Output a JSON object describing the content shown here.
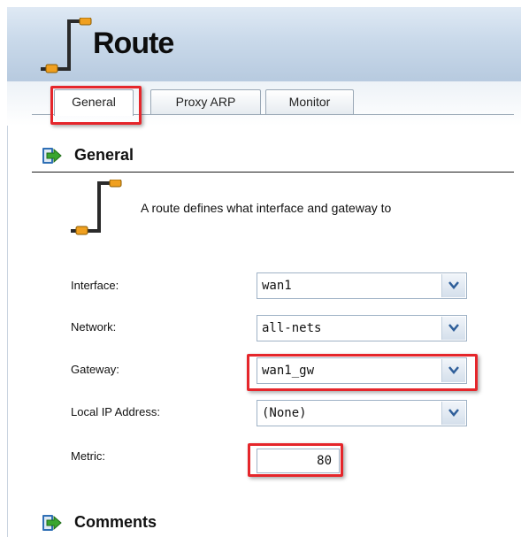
{
  "window": {
    "title": "Route"
  },
  "tabs": [
    {
      "label": "General",
      "active": true,
      "highlighted": true
    },
    {
      "label": "Proxy ARP",
      "active": false,
      "highlighted": false
    },
    {
      "label": "Monitor",
      "active": false,
      "highlighted": false
    }
  ],
  "sections": {
    "general": {
      "title": "General",
      "icon": "section-arrow-icon"
    },
    "comments": {
      "title": "Comments",
      "icon": "section-arrow-icon"
    }
  },
  "description": {
    "text": "A route defines what interface and gateway to",
    "icon": "route-icon"
  },
  "form": {
    "interface": {
      "label": "Interface:",
      "value": "wan1"
    },
    "network": {
      "label": "Network:",
      "value": "all-nets"
    },
    "gateway": {
      "label": "Gateway:",
      "value": "wan1_gw",
      "highlighted": true
    },
    "local_ip": {
      "label": "Local IP Address:",
      "value": "(None)"
    },
    "metric": {
      "label": "Metric:",
      "value": "80",
      "highlighted": true
    }
  },
  "colors": {
    "highlight": "#e5262b",
    "title_bar": "#c9d9ea",
    "arrow_green": "#3aa52f",
    "arrow_blue": "#2f6fb5",
    "icon_orange": "#f0a020"
  }
}
